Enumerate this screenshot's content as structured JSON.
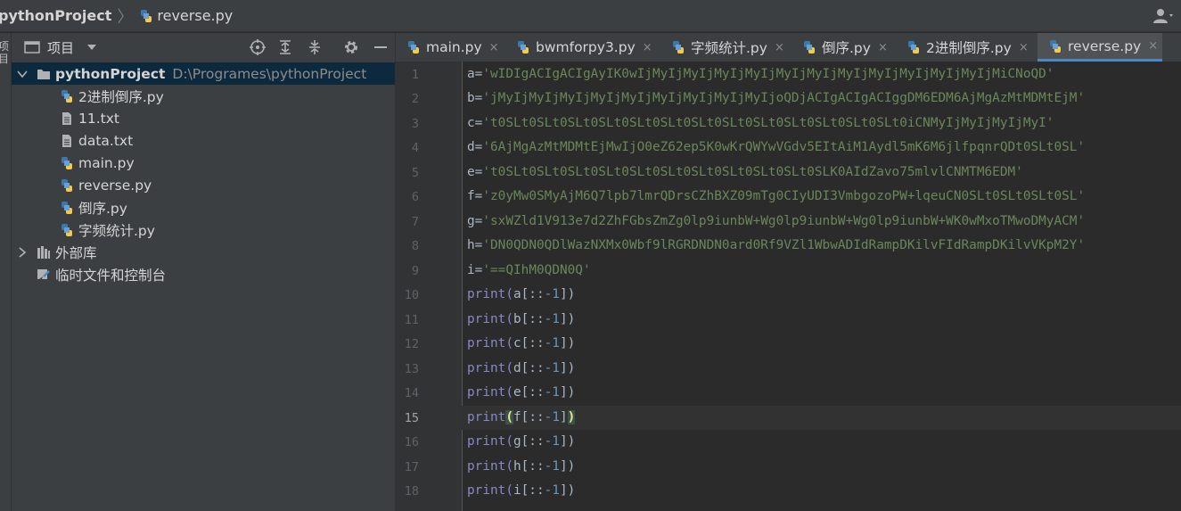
{
  "breadcrumb": {
    "project": "pythonProject",
    "separator": "〉",
    "file": "reverse.py"
  },
  "side_strip": {
    "label": "项目"
  },
  "project_panel": {
    "title": "项目",
    "tree": [
      {
        "label": "pythonProject",
        "path": "D:\\Programes\\pythonProject",
        "icon": "folder-icon"
      },
      {
        "label": "2进制倒序.py",
        "icon": "python-file-icon"
      },
      {
        "label": "11.txt",
        "icon": "text-file-icon"
      },
      {
        "label": "data.txt",
        "icon": "text-file-icon"
      },
      {
        "label": "main.py",
        "icon": "python-file-icon"
      },
      {
        "label": "reverse.py",
        "icon": "python-file-icon"
      },
      {
        "label": "倒序.py",
        "icon": "python-file-icon"
      },
      {
        "label": "字频统计.py",
        "icon": "python-file-icon"
      },
      {
        "label": "外部库",
        "icon": "library-icon"
      },
      {
        "label": "临时文件和控制台",
        "icon": "scratches-icon"
      }
    ]
  },
  "tabs": [
    {
      "label": "main.py",
      "close": "×"
    },
    {
      "label": "bwmforpy3.py",
      "close": "×"
    },
    {
      "label": "字频统计.py",
      "close": "×"
    },
    {
      "label": "倒序.py",
      "close": "×"
    },
    {
      "label": "2进制倒序.py",
      "close": "×"
    },
    {
      "label": "reverse.py",
      "close": "×"
    }
  ],
  "editor": {
    "current_line": 15,
    "lines": [
      {
        "n": "1",
        "var": "a",
        "str": "'wIDIgACIgACIgAyIK0wIjMyIjMyIjMyIjMyIjMyIjMyIjMyIjMyIjMyIjMyIjMyIjMiCNoQD'"
      },
      {
        "n": "2",
        "var": "b",
        "str": "'jMyIjMyIjMyIjMyIjMyIjMyIjMyIjMyIjMyIjoQDjACIgACIgACIggDM6EDM6AjMgAzMtMDMtEjM'"
      },
      {
        "n": "3",
        "var": "c",
        "str": "'t0SLt0SLt0SLt0SLt0SLt0SLt0SLt0SLt0SLt0SLt0SLt0SLt0SLt0iCNMyIjMyIjMyIjMyI'"
      },
      {
        "n": "4",
        "var": "d",
        "str": "'6AjMgAzMtMDMtEjMwIjO0eZ62ep5K0wKrQWYwVGdv5EItAiM1Aydl5mK6M6jlfpqnrQDt0SLt0SL'"
      },
      {
        "n": "5",
        "var": "e",
        "str": "'t0SLt0SLt0SLt0SLt0SLt0SLt0SLt0SLt0SLt0SLt0SLK0AIdZavo75mlvlCNMTM6EDM'"
      },
      {
        "n": "6",
        "var": "f",
        "str": "'z0yMw0SMyAjM6Q7lpb7lmrQDrsCZhBXZ09mTg0CIyUDI3VmbgozoPW+lqeuCN0SLt0SLt0SLt0SL'"
      },
      {
        "n": "7",
        "var": "g",
        "str": "'sxWZld1V913e7d2ZhFGbsZmZg0lp9iunbW+Wg0lp9iunbW+Wg0lp9iunbW+WK0wMxoTMwoDMyACM'"
      },
      {
        "n": "8",
        "var": "h",
        "str": "'DN0QDN0QDlWazNXMx0Wbf9lRGRDNDN0ard0Rf9VZl1WbwADIdRampDKilvFIdRampDKilvVKpM2Y'"
      },
      {
        "n": "9",
        "var": "i",
        "str": "'==QIhM0QDN0Q'"
      },
      {
        "n": "10",
        "p": "print(",
        "arg": "a[::",
        "neg": "-1",
        "end": "])"
      },
      {
        "n": "11",
        "p": "print(",
        "arg": "b[::",
        "neg": "-1",
        "end": "])"
      },
      {
        "n": "12",
        "p": "print(",
        "arg": "c[::",
        "neg": "-1",
        "end": "])"
      },
      {
        "n": "13",
        "p": "print(",
        "arg": "d[::",
        "neg": "-1",
        "end": "])"
      },
      {
        "n": "14",
        "p": "print(",
        "arg": "e[::",
        "neg": "-1",
        "end": "])"
      },
      {
        "n": "15",
        "p": "print",
        "open": "(",
        "arg": "f[::",
        "neg": "-1",
        "close1": "]",
        "close2": ")"
      },
      {
        "n": "16",
        "p": "print(",
        "arg": "g[::",
        "neg": "-1",
        "end": "])"
      },
      {
        "n": "17",
        "p": "print(",
        "arg": "h[::",
        "neg": "-1",
        "end": "])"
      },
      {
        "n": "18",
        "p": "print(",
        "arg": "i[::",
        "neg": "-1",
        "end": "])"
      }
    ]
  },
  "colors": {
    "accent": "#4a88c7",
    "string": "#6a8759",
    "keyword": "#8888c6",
    "number": "#6897bb",
    "selection": "#0d293e"
  }
}
